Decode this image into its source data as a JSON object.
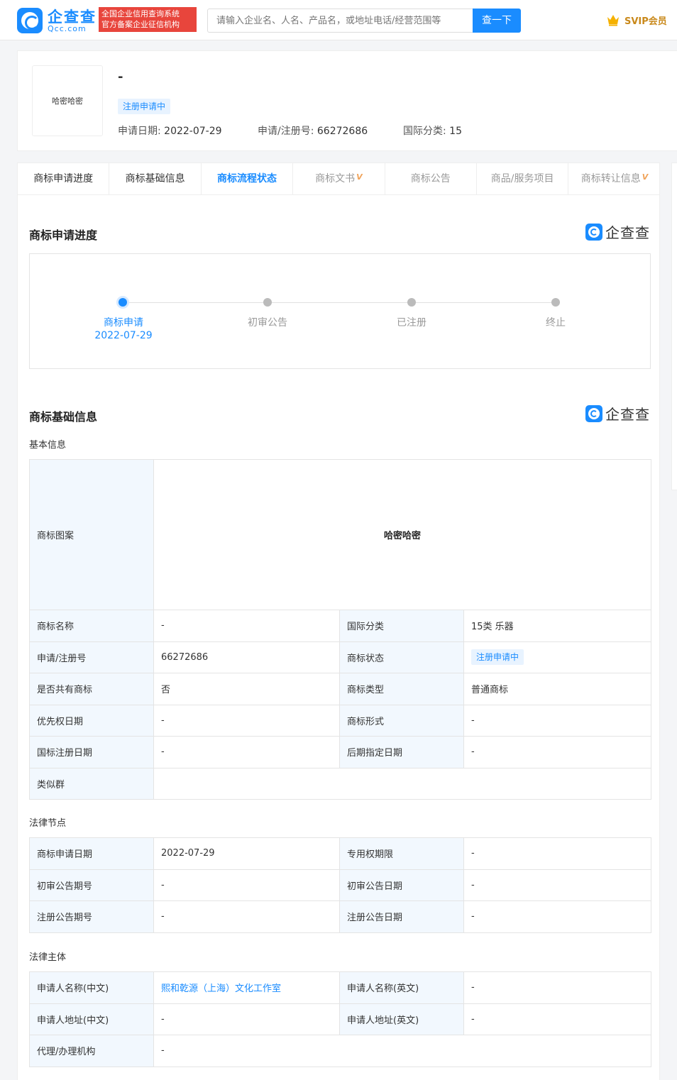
{
  "header": {
    "logo_cn": "企查查",
    "logo_en": "Qcc.com",
    "badge_line1": "全国企业信用查询系统",
    "badge_line2": "官方备案企业征信机构",
    "search_placeholder": "请输入企业名、人名、产品名，或地址电话/经营范围等",
    "search_button": "查一下",
    "svip_label": "SVIP会员"
  },
  "summary": {
    "thumb_text": "哈密哈密",
    "title": "-",
    "status": "注册申请中",
    "apply_date_label": "申请日期: ",
    "apply_date": "2022-07-29",
    "reg_no_label": "申请/注册号: ",
    "reg_no": "66272686",
    "intl_class_label": "国际分类: ",
    "intl_class": "15"
  },
  "tabs": [
    {
      "label": "商标申请进度"
    },
    {
      "label": "商标基础信息"
    },
    {
      "label": "商标流程状态"
    },
    {
      "label": "商标文书"
    },
    {
      "label": "商标公告"
    },
    {
      "label": "商品/服务项目"
    },
    {
      "label": "商标转让信息"
    }
  ],
  "vip_mark": "V",
  "brand_text": "企查查",
  "progress": {
    "title": "商标申请进度",
    "steps": [
      {
        "label": "商标申请",
        "date": "2022-07-29"
      },
      {
        "label": "初审公告"
      },
      {
        "label": "已注册"
      },
      {
        "label": "终止"
      }
    ]
  },
  "basic": {
    "title": "商标基础信息",
    "sub_basic": "基本信息",
    "pattern_label": "商标图案",
    "pattern_text": "哈密哈密",
    "rows": [
      [
        "商标名称",
        "-",
        "国际分类",
        "15类 乐器"
      ],
      [
        "申请/注册号",
        "66272686",
        "商标状态",
        "注册申请中"
      ],
      [
        "是否共有商标",
        "否",
        "商标类型",
        "普通商标"
      ],
      [
        "优先权日期",
        "-",
        "商标形式",
        "-"
      ],
      [
        "国标注册日期",
        "-",
        "后期指定日期",
        "-"
      ]
    ],
    "similar_label": "类似群",
    "similar_value": "",
    "sub_legal": "法律节点",
    "legal_rows": [
      [
        "商标申请日期",
        "2022-07-29",
        "专用权期限",
        "-"
      ],
      [
        "初审公告期号",
        "-",
        "初审公告日期",
        "-"
      ],
      [
        "注册公告期号",
        "-",
        "注册公告日期",
        "-"
      ]
    ],
    "sub_subject": "法律主体",
    "subject_rows": [
      [
        "申请人名称(中文)",
        "熙和乾源（上海）文化工作室",
        "申请人名称(英文)",
        "-"
      ],
      [
        "申请人地址(中文)",
        "-",
        "申请人地址(英文)",
        "-"
      ]
    ],
    "agent_label": "代理/办理机构",
    "agent_value": "-"
  }
}
